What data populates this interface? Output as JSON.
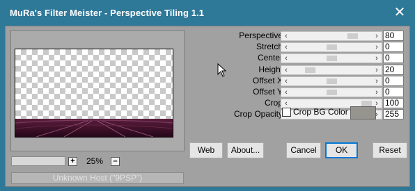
{
  "window": {
    "title": "MuRa's Filter Meister - Perspective Tiling 1.1",
    "close_glyph": "✕"
  },
  "preview": {
    "zoom": "25%",
    "zoom_in_glyph": "+",
    "zoom_out_glyph": "–"
  },
  "status": "Unknown Host (\"9PSP\")",
  "sliders": [
    {
      "label": "Perspective",
      "value": "80",
      "level": 0.8
    },
    {
      "label": "Stretch",
      "value": "0",
      "level": 0.5
    },
    {
      "label": "Center",
      "value": "0",
      "level": 0.5
    },
    {
      "label": "Height",
      "value": "20",
      "level": 0.2
    },
    {
      "label": "Offset X",
      "value": "0",
      "level": 0.5
    },
    {
      "label": "Offset Y",
      "value": "0",
      "level": 0.5
    },
    {
      "label": "Crop",
      "value": "100",
      "level": 1.0
    },
    {
      "label": "Crop Opacity",
      "value": "255",
      "level": 1.0
    }
  ],
  "arrows": {
    "left": "‹",
    "right": "›"
  },
  "crop_bg": {
    "label": "Crop BG Color",
    "checked": false,
    "color": "#96948e"
  },
  "buttons": {
    "web": "Web",
    "about": "About...",
    "cancel": "Cancel",
    "ok": "OK",
    "reset": "Reset"
  }
}
